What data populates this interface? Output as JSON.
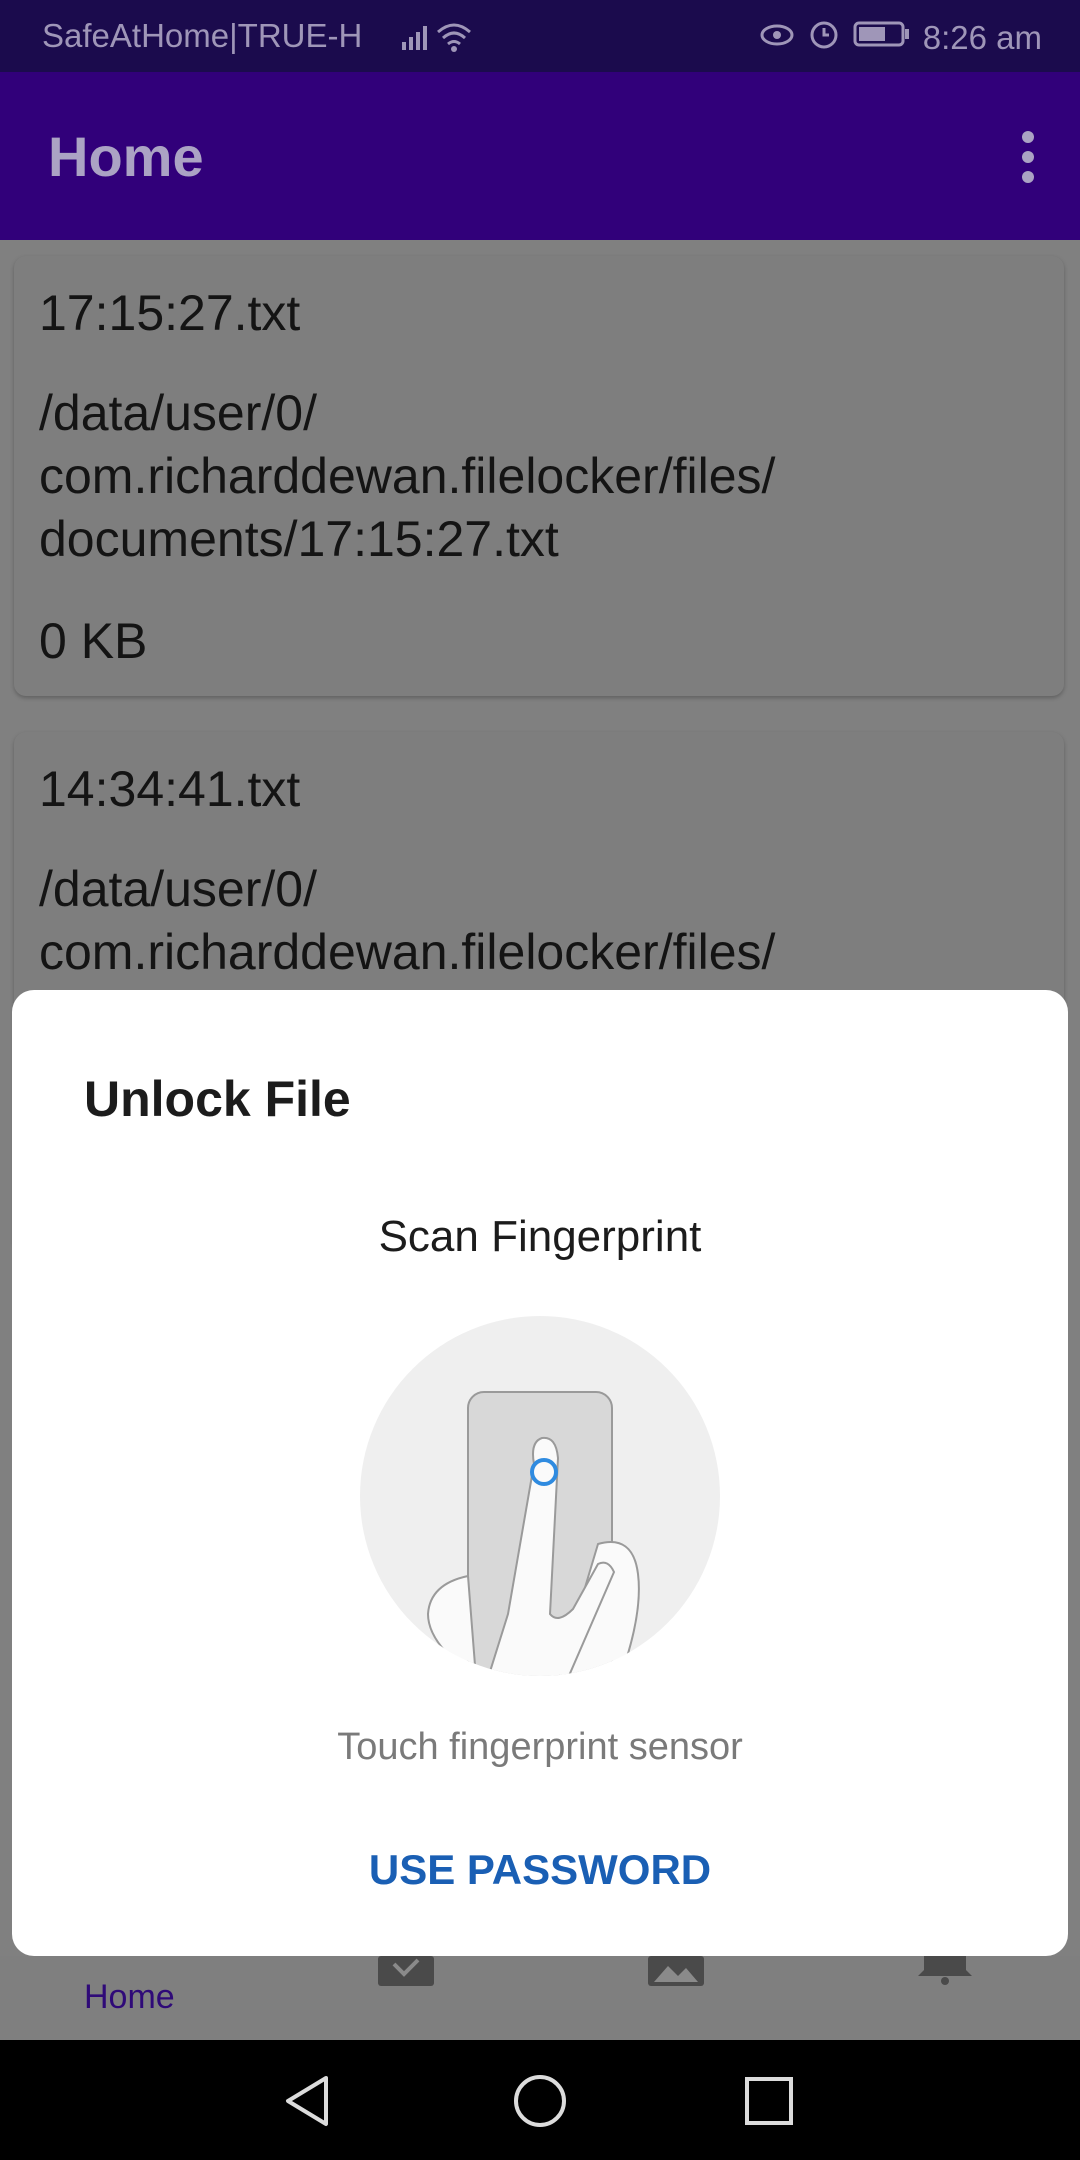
{
  "status_bar": {
    "carrier": "SafeAtHome|TRUE-H",
    "time": "8:26 am"
  },
  "app_bar": {
    "title": "Home"
  },
  "files": [
    {
      "name": "17:15:27.txt",
      "path_lines": [
        "/data/user/0/",
        "com.richarddewan.filelocker/files/",
        "documents/17:15:27.txt"
      ],
      "size": "0 KB"
    },
    {
      "name": "14:34:41.txt",
      "path_lines": [
        "/data/user/0/",
        "com.richarddewan.filelocker/files/"
      ]
    }
  ],
  "dialog": {
    "title": "Unlock File",
    "subtitle": "Scan Fingerprint",
    "hint": "Touch fingerprint sensor",
    "button": "USE PASSWORD"
  },
  "bottom_nav": {
    "home_label": "Home",
    "icons": [
      "document-check-icon",
      "image-icon",
      "bell-icon"
    ]
  },
  "colors": {
    "app_bar": "#31007a",
    "status_bar": "#1b0b4d",
    "accent_link": "#1a5fb4"
  }
}
